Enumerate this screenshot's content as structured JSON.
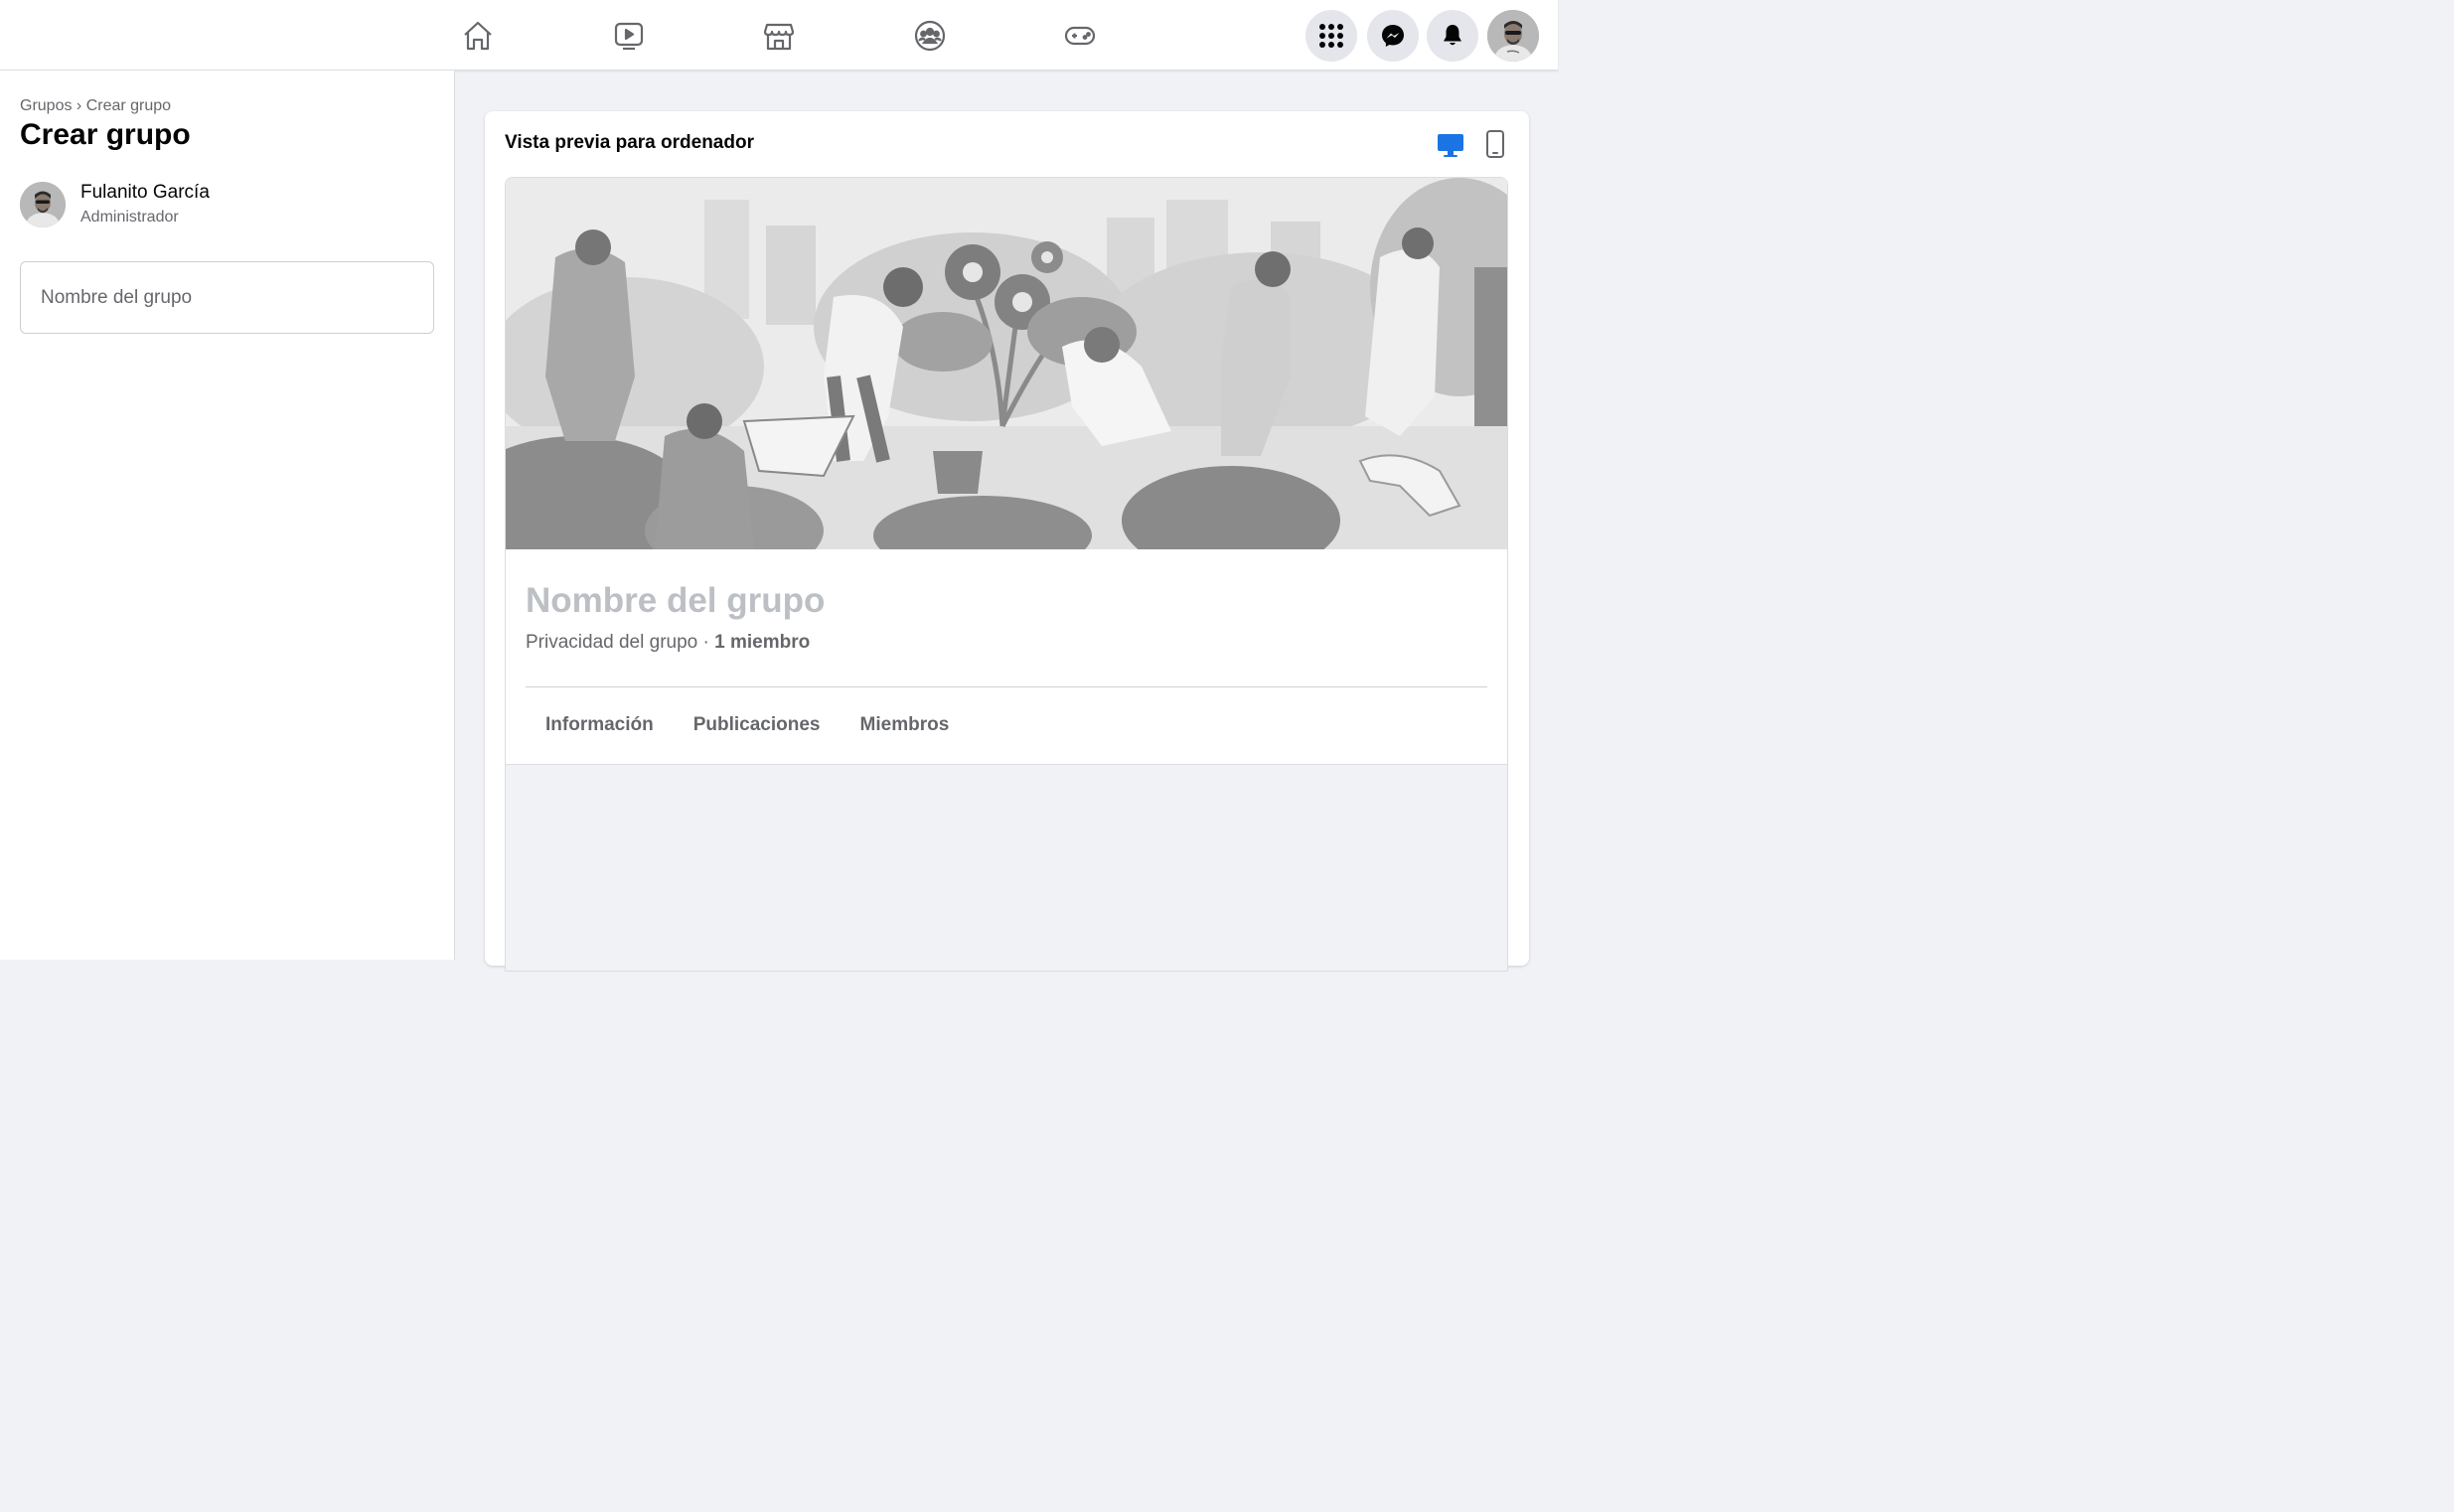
{
  "topbar": {
    "nav": [
      {
        "name": "home-icon"
      },
      {
        "name": "watch-icon"
      },
      {
        "name": "marketplace-icon"
      },
      {
        "name": "groups-icon"
      },
      {
        "name": "gaming-icon"
      }
    ],
    "actions": [
      {
        "name": "menu-grid-icon"
      },
      {
        "name": "messenger-icon"
      },
      {
        "name": "notifications-bell-icon"
      }
    ],
    "avatar": "profile-avatar"
  },
  "left": {
    "breadcrumb_parent": "Grupos",
    "breadcrumb_sep": "›",
    "breadcrumb_current": "Crear grupo",
    "title": "Crear grupo",
    "admin_name": "Fulanito García",
    "admin_role": "Administrador",
    "name_placeholder": "Nombre del grupo"
  },
  "preview": {
    "title": "Vista previa para ordenador",
    "group_name": "Nombre del grupo",
    "privacy": "Privacidad del grupo",
    "separator": " · ",
    "members": "1 miembro",
    "tabs": [
      "Información",
      "Publicaciones",
      "Miembros"
    ],
    "active_device_color": "#1b74e4"
  }
}
